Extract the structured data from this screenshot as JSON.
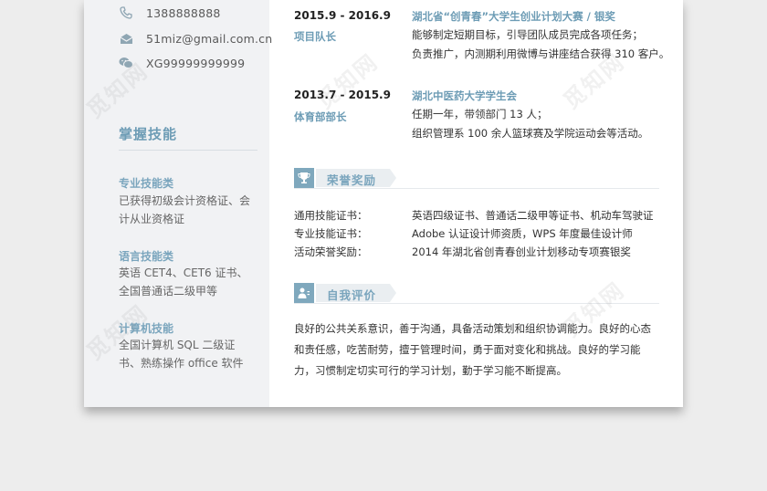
{
  "contact": {
    "phone": "1388888888",
    "email": "51miz@gmail.com.cn",
    "wechat": "XG99999999999"
  },
  "skills": {
    "heading": "掌握技能",
    "groups": [
      {
        "category": "专业技能类",
        "text": "已获得初级会计资格证、会计从业资格证"
      },
      {
        "category": "语言技能类",
        "text": "英语 CET4、CET6 证书、全国普通话二级甲等"
      },
      {
        "category": "计算机技能",
        "text": "全国计算机 SQL 二级证书、熟练操作 office 软件"
      }
    ]
  },
  "experience": [
    {
      "date": "2015.9 - 2016.9",
      "role": "项目队长",
      "org": "湖北省“创青春”大学生创业计划大赛 / 银奖",
      "lines": [
        "能够制定短期目标，引导团队成员完成各项任务；",
        "负责推广，内测期利用微博与讲座结合获得 310 客户。"
      ]
    },
    {
      "date": "2013.7 - 2015.9",
      "role": "体育部部长",
      "org": "湖北中医药大学学生会",
      "lines": [
        "任期一年，带领部门 13 人；",
        "组织管理系 100 余人篮球赛及学院运动会等活动。"
      ]
    }
  ],
  "awards": {
    "heading": "荣誉奖励",
    "items": [
      {
        "label": "通用技能证书：",
        "value": "英语四级证书、普通话二级甲等证书、机动车驾驶证"
      },
      {
        "label": "专业技能证书：",
        "value": "Adobe 认证设计师资质，WPS 年度最佳设计师"
      },
      {
        "label": "活动荣誉奖励：",
        "value": "2014 年湖北省创青春创业计划移动专项赛银奖"
      }
    ]
  },
  "self_eval": {
    "heading": "自我评价",
    "text": "良好的公共关系意识，善于沟通，具备活动策划和组织协调能力。良好的心态和责任感，吃苦耐劳，擅于管理时间，勇于面对变化和挑战。良好的学习能力，习惯制定切实可行的学习计划，勤于学习能不断提高。"
  },
  "watermark": "觅知网",
  "colors": {
    "accent": "#7fa8bd",
    "sidebar": "#f1f2f4",
    "background": "#ededed"
  }
}
